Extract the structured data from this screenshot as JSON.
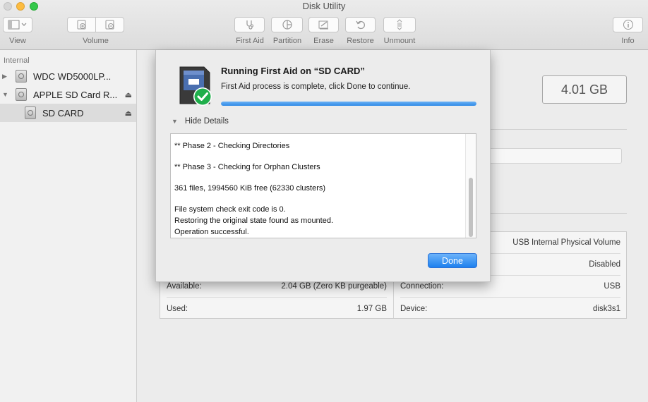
{
  "window": {
    "title": "Disk Utility"
  },
  "toolbar": {
    "view_label": "View",
    "volume_label": "Volume",
    "first_aid_label": "First Aid",
    "partition_label": "Partition",
    "erase_label": "Erase",
    "restore_label": "Restore",
    "unmount_label": "Unmount",
    "info_label": "Info"
  },
  "sidebar": {
    "section": "Internal",
    "items": [
      {
        "label": "WDC WD5000LP..."
      },
      {
        "label": "APPLE SD Card R..."
      },
      {
        "label": "SD CARD"
      }
    ]
  },
  "volume": {
    "capacity": "4.01 GB",
    "info": {
      "right_top1": {
        "label": "",
        "value": "USB Internal Physical Volume"
      },
      "right_top2": {
        "label": "",
        "value": "Disabled"
      },
      "available": {
        "label": "Available:",
        "value": "2.04 GB (Zero KB purgeable)"
      },
      "used": {
        "label": "Used:",
        "value": "1.97 GB"
      },
      "connection": {
        "label": "Connection:",
        "value": "USB"
      },
      "device": {
        "label": "Device:",
        "value": "disk3s1"
      }
    }
  },
  "dialog": {
    "title": "Running First Aid on “SD CARD”",
    "subtitle": "First Aid process is complete, click Done to continue.",
    "progress": 1.0,
    "details_toggle": "Hide Details",
    "log": [
      "** Phase 2 - Checking Directories",
      "",
      "** Phase 3 - Checking for Orphan Clusters",
      "",
      "361 files, 1994560 KiB free (62330 clusters)",
      "",
      "File system check exit code is 0.",
      "Restoring the original state found as mounted.",
      "Operation successful."
    ],
    "done_label": "Done"
  },
  "colors": {
    "accent": "#2f8ae7",
    "check_green": "#1fae4b"
  }
}
